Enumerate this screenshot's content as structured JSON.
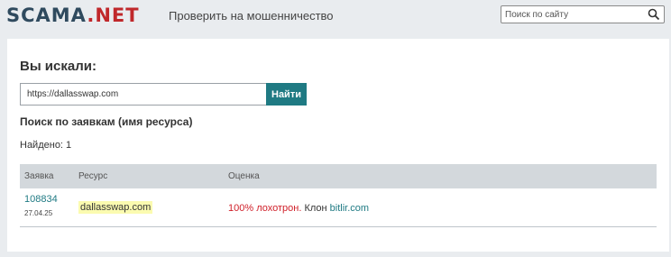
{
  "header": {
    "logo_main": "SCAMA",
    "logo_dot": ".",
    "logo_suffix": "NET",
    "nav_link": "Проверить на мошенничество",
    "search_placeholder": "Поиск по сайту"
  },
  "main": {
    "searched_title": "Вы искали:",
    "query_value": "https://dallasswap.com",
    "find_button": "Найти",
    "section_title": "Поиск по заявкам (имя ресурса)",
    "found_text": "Найдено: 1",
    "table": {
      "columns": [
        "Заявка",
        "Ресурс",
        "Оценка"
      ],
      "rows": [
        {
          "claim_id": "108834",
          "date": "27.04.25",
          "resource": "dallasswap.com",
          "rating_scam": "100% лохотрон.",
          "rating_clone_prefix": " Клон ",
          "rating_clone_link": "bitlir.com"
        }
      ]
    }
  },
  "colors": {
    "accent": "#1f7a83",
    "brand_dark": "#2f4a5e",
    "brand_red": "#c0282b",
    "scam_red": "#d0202a",
    "highlight": "#fbfbb0"
  }
}
